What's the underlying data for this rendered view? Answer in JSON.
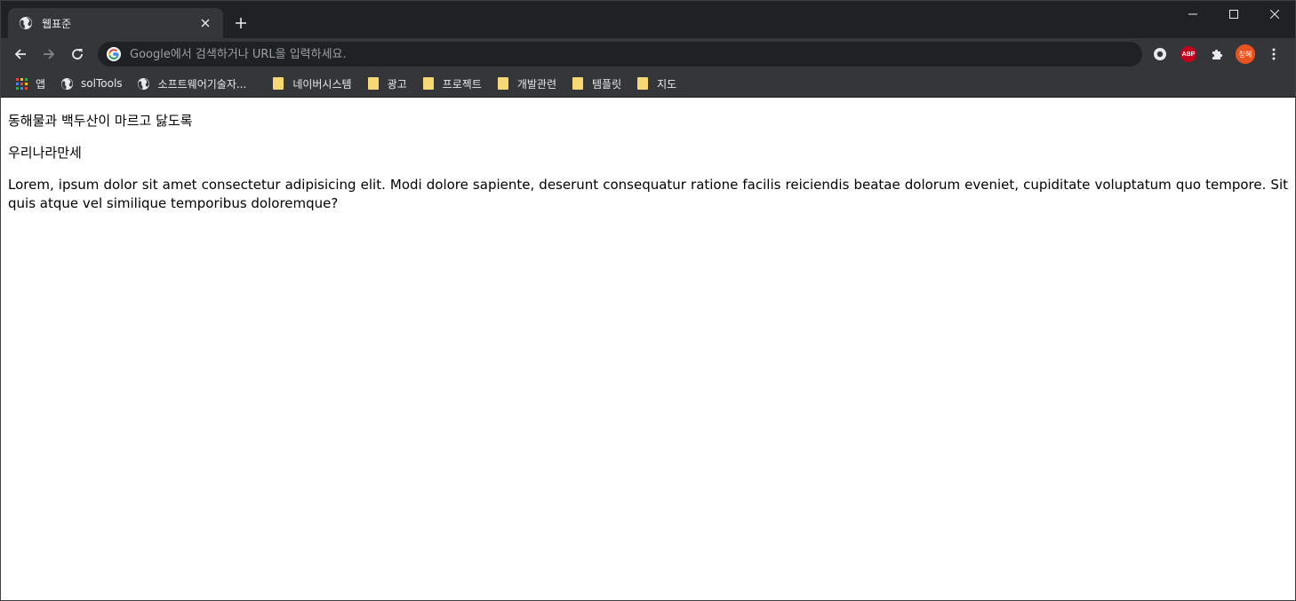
{
  "browser": {
    "tab": {
      "title": "웹표준",
      "favicon": "globe-icon"
    },
    "omnibox": {
      "placeholder": "Google에서 검색하거나 URL을 입력하세요."
    },
    "extensions": {
      "abp_label": "ABP",
      "profile_label": "창혜"
    },
    "bookmarks": [
      {
        "label": "앱",
        "icon": "apps-grid-icon"
      },
      {
        "label": "solTools",
        "icon": "globe-icon"
      },
      {
        "label": "소프트웨어기술자...",
        "icon": "globe-icon"
      },
      {
        "label": "네이버시스템",
        "icon": "folder-icon"
      },
      {
        "label": "광고",
        "icon": "folder-icon"
      },
      {
        "label": "프로젝트",
        "icon": "folder-icon"
      },
      {
        "label": "개발관련",
        "icon": "folder-icon"
      },
      {
        "label": "템플릿",
        "icon": "folder-icon"
      },
      {
        "label": "지도",
        "icon": "folder-icon"
      }
    ],
    "colors": {
      "titlebar": "#202124",
      "toolbar": "#35363a",
      "folder": "#f8d775",
      "abp": "#c4001c",
      "avatar": "#e8531f"
    }
  },
  "page": {
    "paragraphs": [
      "동해물과 백두산이 마르고 닳도록",
      "우리나라만세",
      "Lorem, ipsum dolor sit amet consectetur adipisicing elit. Modi dolore sapiente, deserunt consequatur ratione facilis reiciendis beatae dolorum eveniet, cupiditate voluptatum quo tempore. Sit quis atque vel similique temporibus doloremque?"
    ]
  }
}
